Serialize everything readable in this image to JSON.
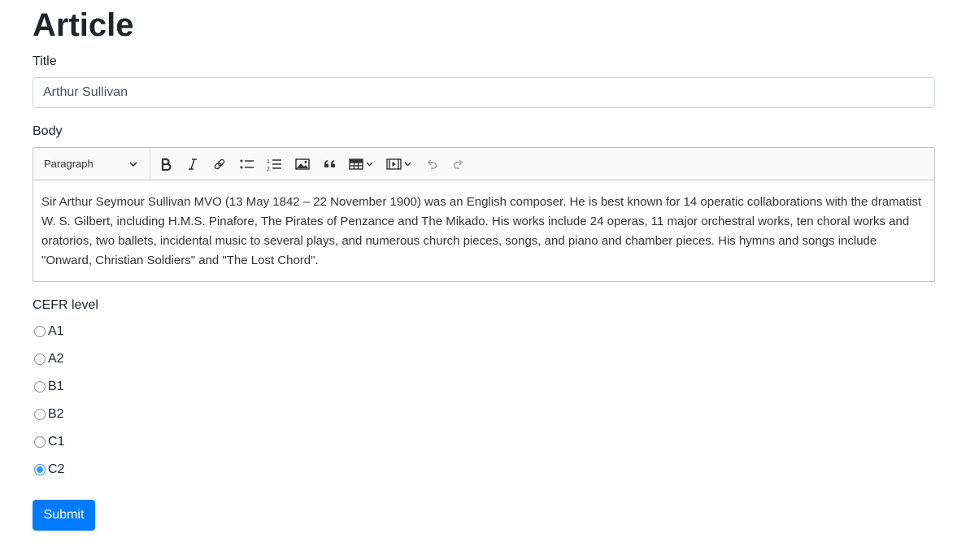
{
  "page": {
    "title": "Article"
  },
  "form": {
    "title_label": "Title",
    "title_value": "Arthur Sullivan",
    "body_label": "Body",
    "cefr_label": "CEFR level",
    "submit_label": "Submit"
  },
  "editor": {
    "heading_dropdown": "Paragraph",
    "toolbar_icons": [
      "bold-icon",
      "italic-icon",
      "link-icon",
      "bulleted-list-icon",
      "numbered-list-icon",
      "image-icon",
      "block-quote-icon",
      "table-icon",
      "media-icon",
      "undo-icon",
      "redo-icon"
    ],
    "content": "Sir Arthur Seymour Sullivan MVO (13 May 1842 – 22 November 1900) was an English composer. He is best known for 14 operatic collaborations with the dramatist W. S. Gilbert, including H.M.S. Pinafore, The Pirates of Penzance and The Mikado. His works include 24 operas, 11 major orchestral works, ten choral works and oratorios, two ballets, incidental music to several plays, and numerous church pieces, songs, and piano and chamber pieces. His hymns and songs include \"Onward, Christian Soldiers\" and \"The Lost Chord\"."
  },
  "cefr_options": [
    {
      "label": "A1",
      "checked": false
    },
    {
      "label": "A2",
      "checked": false
    },
    {
      "label": "B1",
      "checked": false
    },
    {
      "label": "B2",
      "checked": false
    },
    {
      "label": "C1",
      "checked": false
    },
    {
      "label": "C2",
      "checked": true
    }
  ],
  "colors": {
    "primary": "#007bff",
    "radio_checked": "#3b99fc"
  }
}
